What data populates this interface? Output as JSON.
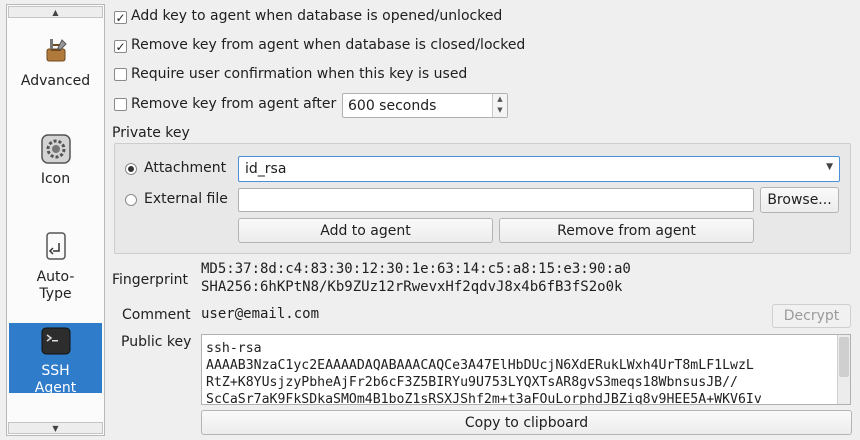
{
  "sidebar": {
    "items": [
      {
        "label": "Advanced",
        "icon": "toolbox-icon"
      },
      {
        "label": "Icon",
        "icon": "gear-icon"
      },
      {
        "label_line1": "Auto-",
        "label_line2": "Type",
        "icon": "keyboard-key-icon"
      },
      {
        "label_line1": "SSH",
        "label_line2": "Agent",
        "icon": "terminal-icon",
        "selected": true
      }
    ]
  },
  "options": {
    "add_on_open": {
      "label": "Add key to agent when database is opened/unlocked",
      "checked": true
    },
    "remove_on_close": {
      "label": "Remove key from agent when database is closed/locked",
      "checked": true
    },
    "require_confirm": {
      "label": "Require user confirmation when this key is used",
      "checked": false
    },
    "remove_after": {
      "label": "Remove key from agent after",
      "checked": false,
      "value": "600 seconds"
    }
  },
  "private_key": {
    "heading": "Private key",
    "attachment_label": "Attachment",
    "attachment_value": "id_rsa",
    "external_file_label": "External file",
    "external_file_value": "",
    "browse_label": "Browse...",
    "add_label": "Add to agent",
    "remove_label": "Remove from agent"
  },
  "fingerprint": {
    "label": "Fingerprint",
    "md5": "MD5:37:8d:c4:83:30:12:30:1e:63:14:c5:a8:15:e3:90:a0",
    "sha256": "SHA256:6hKPtN8/Kb9ZUz12rRwevxHf2qdvJ8x4b6fB3fS2o0k"
  },
  "comment": {
    "label": "Comment",
    "value": "user@email.com",
    "decrypt_label": "Decrypt"
  },
  "public_key": {
    "label": "Public key",
    "line1": "ssh-rsa",
    "line2": "AAAAB3NzaC1yc2EAAAADAQABAAACAQCe3A47ElHbDUcjN6XdERukLWxh4UrT8mLF1LwzL",
    "line3": "RtZ+K8YUsjzyPbheAjFr2b6cF3Z5BIRYu9U753LYQXTsAR8gvS3meqs18WbnsusJB//",
    "line4": "ScCaSr7aK9FkSDkaSMOm4B1boZ1sRSXJShf2m+t3aFOuLorphdJBZiq8v9HEE5A+WKV6Iv",
    "copy_label": "Copy to clipboard"
  }
}
